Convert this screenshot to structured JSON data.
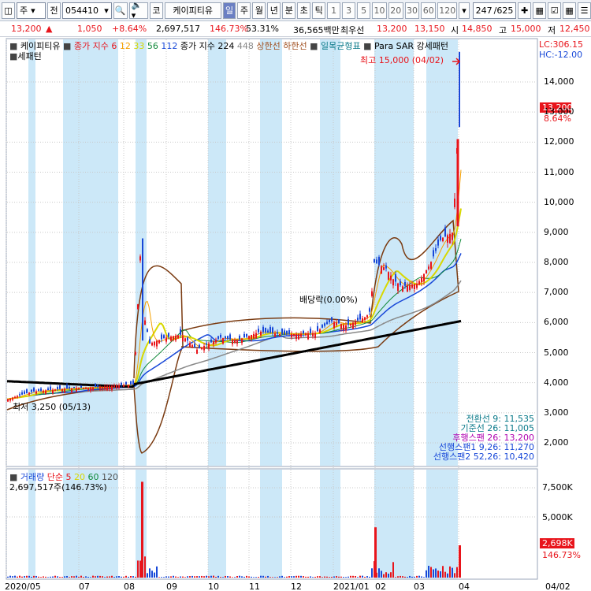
{
  "toolbar": {
    "market": "주",
    "prefix": "전",
    "code": "054410",
    "name": "케이피티유",
    "periods": [
      "일",
      "주",
      "월",
      "년",
      "분",
      "초",
      "틱"
    ],
    "active_period": "일",
    "numbers": [
      "1",
      "3",
      "5",
      "10",
      "20",
      "30",
      "60",
      "120"
    ],
    "page_count": "247",
    "page_total": "/625"
  },
  "quote": {
    "price": "13,200",
    "change": "1,050",
    "change_pct": "+8.64%",
    "volume": "2,697,517",
    "vol_ratio": "146.73%",
    "turnover": "53.31%",
    "amount": "36,565백만",
    "best_label": "최우선",
    "best_ask": "13,200",
    "best_bid": "13,150",
    "open_label": "시",
    "open": "14,850",
    "high_label": "고",
    "high": "15,000",
    "low_label": "저",
    "low": "12,450"
  },
  "price_panel": {
    "legend": {
      "name": "케이피티유",
      "close_label": "종가 지수 6",
      "ma12": "12",
      "ma33": "33",
      "ma56": "56",
      "ma112": "112",
      "close_224": "종가 지수 224",
      "ma448": "448",
      "upper": "상한선",
      "lower": "하한선",
      "ichimoku": "일목균형표",
      "psar": "Para SAR",
      "strong": "강세패턴"
    },
    "lc": "LC:306.15",
    "hc": "HC:-12.00",
    "high_note": "최고 15,000 (04/02)",
    "low_note": "최저 3,250 (05/13)",
    "dividend_note": "배당락(0.00%)",
    "cur_price": "13,200",
    "cur_pct": "8.64%",
    "yticks": [
      "14,000",
      "13,000",
      "12,000",
      "11,000",
      "10,000",
      "9,000",
      "8,000",
      "7,000",
      "6,000",
      "5,000",
      "4,000",
      "3,000",
      "2,000"
    ],
    "ichimoku_readout": [
      "전환선 9: 11,535",
      "기준선 26: 11,005",
      "후행스팬 26: 13,200",
      "선행스팬1 9,26: 11,270",
      "선행스팬2 52,26: 10,420"
    ]
  },
  "volume_panel": {
    "label": "거래량",
    "ma_label": "단순 5",
    "ma20": "20",
    "ma60": "60",
    "ma120": "120",
    "value": "2,697,517주(146.73%)",
    "yticks": [
      "7,500K",
      "5,000K",
      "2,500K"
    ],
    "cur_value": "2,698K",
    "cur_pct": "146.73%"
  },
  "xaxis": {
    "labels": [
      "2020/05",
      "07",
      "08",
      "09",
      "10",
      "11",
      "12",
      "2021/01",
      "02",
      "03",
      "04"
    ],
    "end_label": "04/02"
  },
  "colors": {
    "up": "#e8141b",
    "down": "#1848d8",
    "band": "#cce8f8",
    "black_line": "#000000",
    "brown": "#7a3a10"
  }
}
